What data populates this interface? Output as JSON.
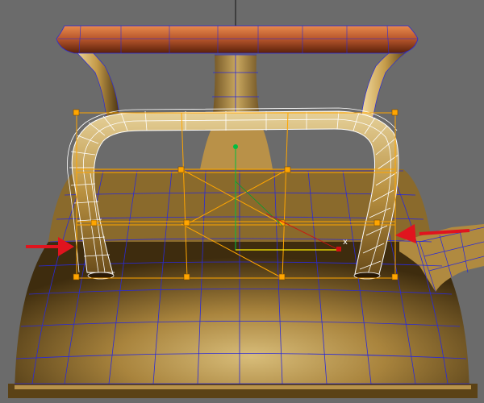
{
  "viewport": {
    "background": "#6b6b6b",
    "object_colors": {
      "body": "#b08a40",
      "lid": "#b4532a",
      "wire": "#2a2ad8",
      "selection_wire": "#ffffff",
      "gizmo": "#ffa500",
      "annotation_arrow": "#e0141e"
    },
    "gizmo": {
      "x_label": "x"
    }
  },
  "annotations": [
    {
      "name": "left-arrow",
      "direction": "right"
    },
    {
      "name": "right-arrow",
      "direction": "left"
    }
  ]
}
